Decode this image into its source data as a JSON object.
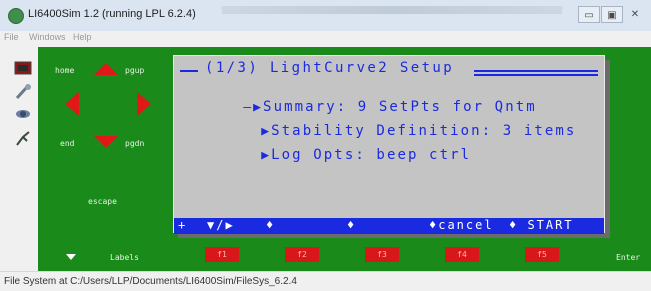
{
  "window": {
    "title": "LI6400Sim 1.2 (running LPL 6.2.4)",
    "minimize_glyph": "▭",
    "maximize_glyph": "▣",
    "close_glyph": "✕"
  },
  "menu": {
    "file": "File",
    "windows": "Windows",
    "help": "Help"
  },
  "nav": {
    "home": "home",
    "pgup": "pgup",
    "end": "end",
    "pgdn": "pgdn",
    "escape": "escape",
    "labels": "Labels",
    "enter": "Enter"
  },
  "lcd": {
    "title": "(1/3) LightCurve2 Setup",
    "lines": [
      "Summary: 9 SetPts for Qntm",
      "Stability Definition: 3 items",
      "Log Opts: beep ctrl"
    ],
    "bottom_bar": {
      "plus": "+",
      "nav": "▼/▶",
      "bullet1": "♦",
      "bullet2": "♦",
      "cancel": "♦cancel",
      "start": "♦ START"
    }
  },
  "fkeys": [
    "f1",
    "f2",
    "f3",
    "f4",
    "f5"
  ],
  "status": "File System at C:/Users/LLP/Documents/LI6400Sim/FileSys_6.2.4",
  "colors": {
    "display_green": "#1a8a1a",
    "lcd_blue": "#1a2ae0",
    "arrow_red": "#e01818",
    "fkey_red": "#d81818"
  }
}
